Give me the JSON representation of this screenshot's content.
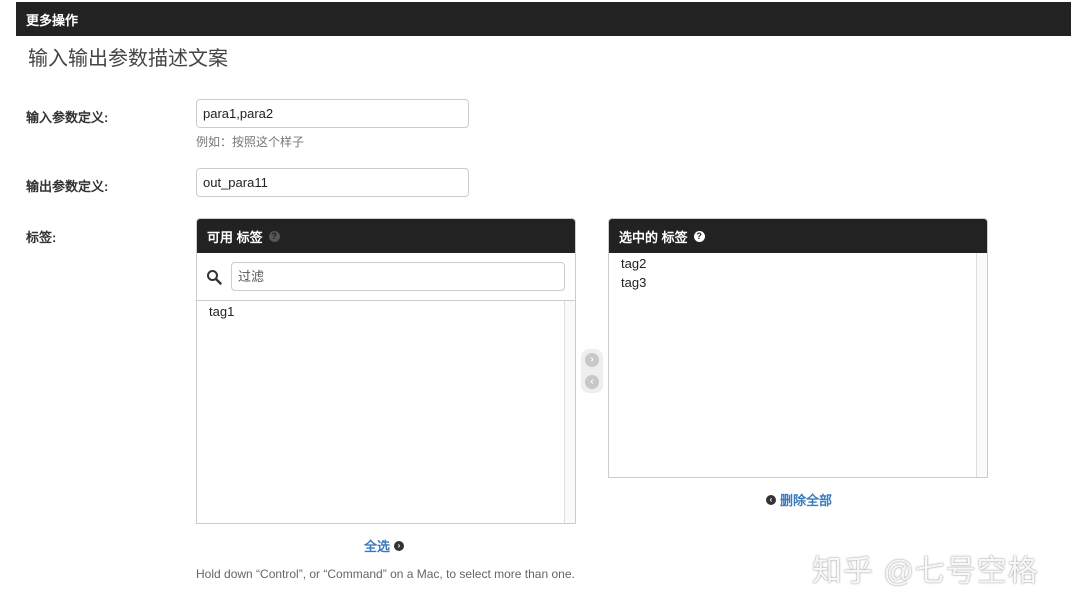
{
  "header": {
    "title": "更多操作"
  },
  "page": {
    "heading": "输入输出参数描述文案"
  },
  "form": {
    "input_params": {
      "label": "输入参数定义:",
      "value": "para1,para2",
      "help": "例如：按照这个样子"
    },
    "output_params": {
      "label": "输出参数定义:",
      "value": "out_para11"
    },
    "tags": {
      "label": "标签:",
      "available": {
        "title": "可用 标签",
        "help_icon": "?",
        "filter_placeholder": "过滤",
        "items": [
          "tag1"
        ],
        "choose_all_label": "全选"
      },
      "selected": {
        "title": "选中的 标签",
        "help_icon": "?",
        "items": [
          "tag2",
          "tag3"
        ],
        "remove_all_label": "删除全部"
      },
      "footer_help": "Hold down “Control”, or “Command” on a Mac, to select more than one."
    }
  },
  "watermark": "知乎 @七号空格",
  "colors": {
    "header_bg": "#222222",
    "link": "#3a7bbf"
  }
}
